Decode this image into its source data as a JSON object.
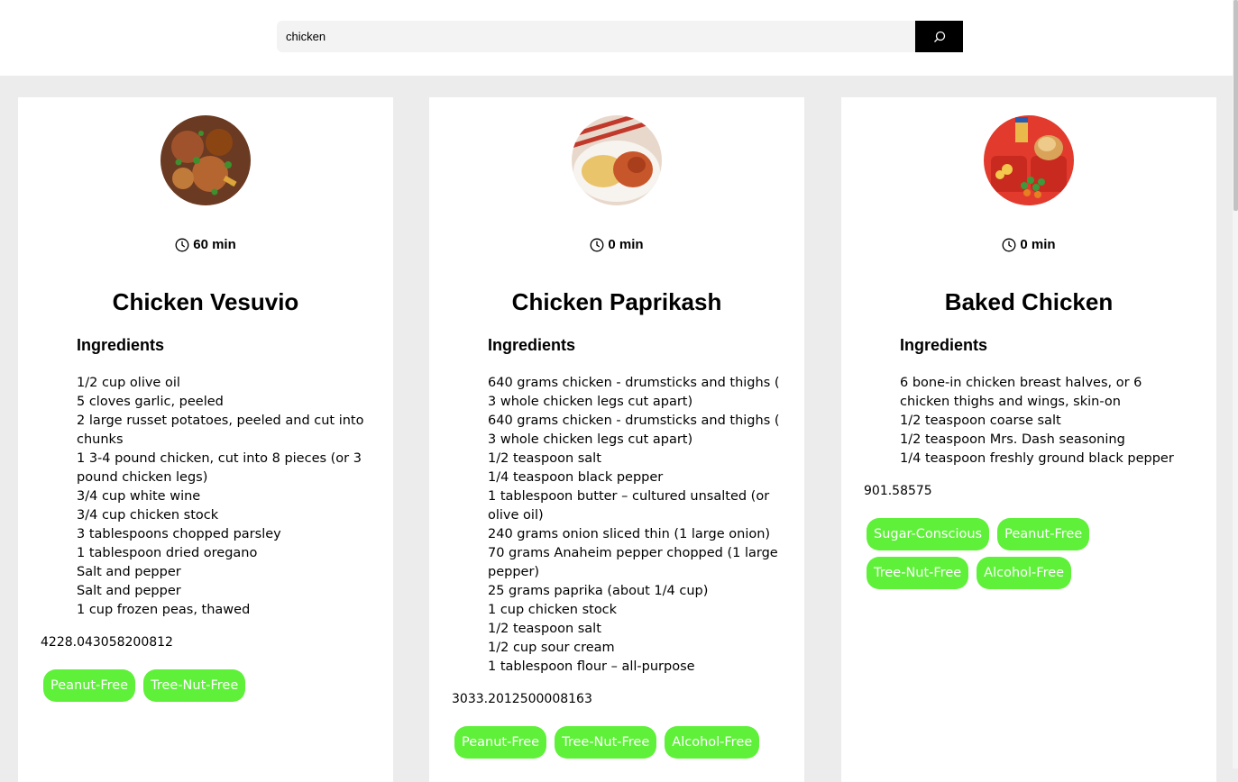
{
  "search": {
    "value": "chicken",
    "button_icon": "search-icon"
  },
  "recipes": [
    {
      "time": "60 min",
      "title": "Chicken Vesuvio",
      "ingredients_heading": "Ingredients",
      "ingredients": [
        "1/2 cup olive oil",
        "5 cloves garlic, peeled",
        "2 large russet potatoes, peeled and cut into chunks",
        "1 3-4 pound chicken, cut into 8 pieces (or 3 pound chicken legs)",
        "3/4 cup white wine",
        "3/4 cup chicken stock",
        "3 tablespoons chopped parsley",
        "1 tablespoon dried oregano",
        "Salt and pepper",
        "Salt and pepper",
        "1 cup frozen peas, thawed"
      ],
      "calories": "4228.043058200812",
      "tags": [
        "Peanut-Free",
        "Tree-Nut-Free"
      ]
    },
    {
      "time": "0 min",
      "title": "Chicken Paprikash",
      "ingredients_heading": "Ingredients",
      "ingredients": [
        "640 grams chicken - drumsticks and thighs ( 3 whole chicken legs cut apart)",
        "640 grams chicken - drumsticks and thighs ( 3 whole chicken legs cut apart)",
        "1/2 teaspoon salt",
        "1/4 teaspoon black pepper",
        "1 tablespoon butter – cultured unsalted (or olive oil)",
        "240 grams onion sliced thin (1 large onion)",
        "70 grams Anaheim pepper chopped (1 large pepper)",
        "25 grams paprika (about 1/4 cup)",
        "1 cup chicken stock",
        "1/2 teaspoon salt",
        "1/2 cup sour cream",
        "1 tablespoon flour – all-purpose"
      ],
      "calories": "3033.2012500008163",
      "tags": [
        "Peanut-Free",
        "Tree-Nut-Free",
        "Alcohol-Free"
      ]
    },
    {
      "time": "0 min",
      "title": "Baked Chicken",
      "ingredients_heading": "Ingredients",
      "ingredients": [
        "6 bone-in chicken breast halves, or 6 chicken thighs and wings, skin-on",
        "1/2 teaspoon coarse salt",
        "1/2 teaspoon Mrs. Dash seasoning",
        "1/4 teaspoon freshly ground black pepper"
      ],
      "calories": "901.58575",
      "tags": [
        "Sugar-Conscious",
        "Peanut-Free",
        "Tree-Nut-Free",
        "Alcohol-Free"
      ]
    }
  ],
  "colors": {
    "tag_bg": "#5ff03a",
    "page_bg": "#ececec",
    "search_button": "#000000"
  }
}
